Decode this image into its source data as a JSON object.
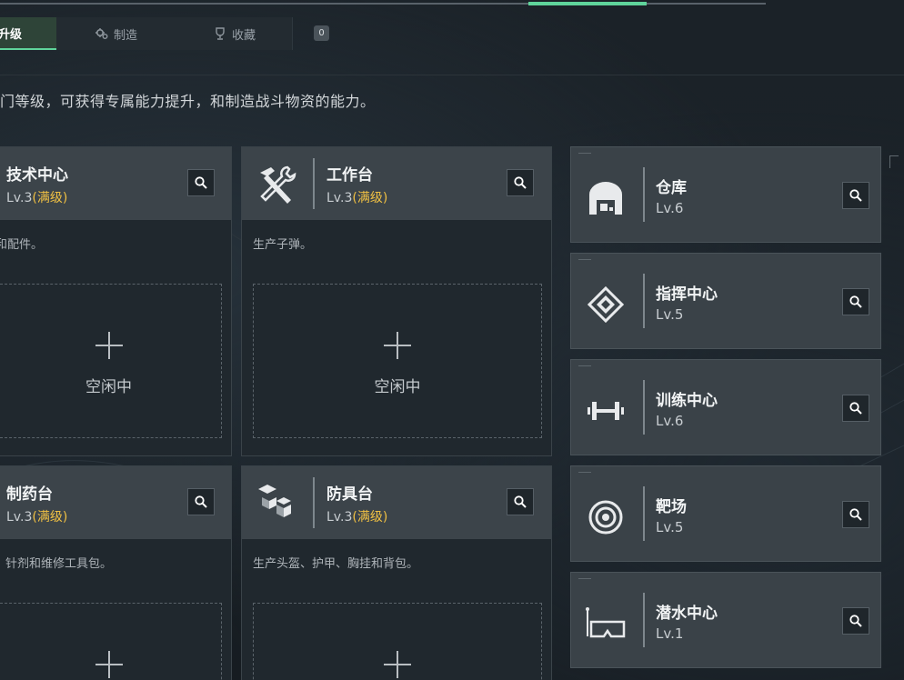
{
  "tabs": [
    {
      "label": "升级",
      "icon": "arrow-up-icon",
      "active": true
    },
    {
      "label": "制造",
      "icon": "gears-icon",
      "active": false
    },
    {
      "label": "收藏",
      "icon": "trophy-icon",
      "active": false
    }
  ],
  "tab_badge": "0",
  "description": "门等级，可获得专属能力提升，和制造战斗物资的能力。",
  "colors": {
    "accent": "#5fd49b",
    "max_level": "#f0c043"
  },
  "facilities": [
    {
      "name": "技术中心",
      "level": "Lv.3",
      "max": "(满级)",
      "desc": "和配件。",
      "slot_status": "空闲中",
      "icon": "tech-center-icon"
    },
    {
      "name": "工作台",
      "level": "Lv.3",
      "max": "(满级)",
      "desc": "生产子弹。",
      "slot_status": "空闲中",
      "icon": "workbench-tools-icon"
    },
    {
      "name": "制药台",
      "level": "Lv.3",
      "max": "(满级)",
      "desc": "针剂和维修工具包。",
      "slot_status": "",
      "icon": "pharmacy-icon"
    },
    {
      "name": "防具台",
      "level": "Lv.3",
      "max": "(满级)",
      "desc": "生产头盔、护甲、胸挂和背包。",
      "slot_status": "",
      "icon": "armor-bench-icon"
    }
  ],
  "side_facilities": [
    {
      "name": "仓库",
      "level": "Lv.6",
      "icon": "warehouse-icon"
    },
    {
      "name": "指挥中心",
      "level": "Lv.5",
      "icon": "command-center-icon"
    },
    {
      "name": "训练中心",
      "level": "Lv.6",
      "icon": "dumbbell-icon"
    },
    {
      "name": "靶场",
      "level": "Lv.5",
      "icon": "target-icon"
    },
    {
      "name": "潜水中心",
      "level": "Lv.1",
      "icon": "diving-mask-icon"
    }
  ]
}
